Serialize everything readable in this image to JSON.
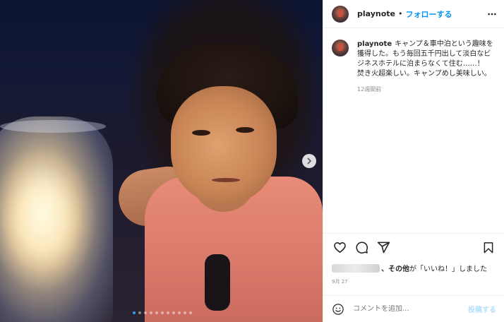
{
  "media": {
    "carousel_dot_count": 11,
    "active_dot_index": 0
  },
  "header": {
    "username": "playnote",
    "separator": "•",
    "follow_label": "フォローする",
    "more_icon": "more-horizontal-icon"
  },
  "caption": {
    "username": "playnote",
    "text": "キャンプ＆車中泊という趣味を獲得した。もう毎回五千円出して淡白なビジネスホテルに泊まらなくて住む……！　焚き火超楽しい。キャンプめし美味しい。",
    "time": "12週間前"
  },
  "actions": {
    "like_icon": "heart-icon",
    "comment_icon": "comment-icon",
    "share_icon": "share-icon",
    "save_icon": "bookmark-icon"
  },
  "likes": {
    "others_label": "、その他",
    "suffix": "が「いいね！」しました"
  },
  "date": "9月 27",
  "comment": {
    "placeholder": "コメントを追加...",
    "post_label": "投稿する",
    "emoji_icon": "smiley-icon"
  },
  "colors": {
    "link_blue": "#0095f6",
    "post_disabled": "#b2dffc",
    "muted_text": "#8e8e8e",
    "active_dot": "#3897f0"
  }
}
